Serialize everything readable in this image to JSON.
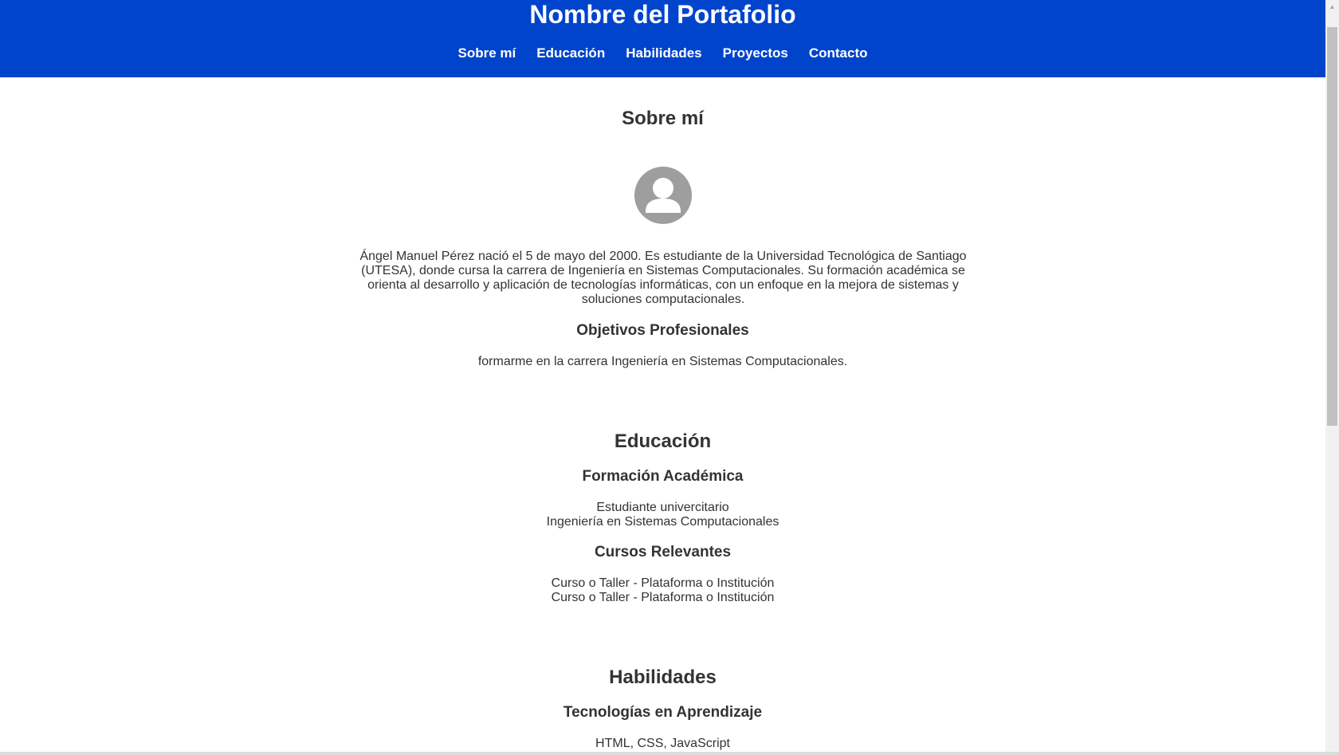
{
  "header": {
    "title": "Nombre del Portafolio",
    "nav": [
      "Sobre mí",
      "Educación",
      "Habilidades",
      "Proyectos",
      "Contacto"
    ]
  },
  "about": {
    "heading": "Sobre mí",
    "avatar_icon": "user-avatar-icon",
    "bio": "Ángel Manuel Pérez nació el 5 de mayo del 2000. Es estudiante de la Universidad Tecnológica de Santiago (UTESA), donde cursa la carrera de Ingeniería en Sistemas Computacionales. Su formación académica se orienta al desarrollo y aplicación de tecnologías informáticas, con un enfoque en la mejora de sistemas y soluciones computacionales.",
    "objectives_heading": "Objetivos Profesionales",
    "objectives_text": "formarme en la carrera Ingeniería en Sistemas Computacionales."
  },
  "education": {
    "heading": "Educación",
    "academic_heading": "Formación Académica",
    "academic_lines": [
      "Estudiante univercitario",
      "Ingeniería en Sistemas Computacionales"
    ],
    "courses_heading": "Cursos Relevantes",
    "courses_lines": [
      "Curso o Taller - Plataforma o Institución",
      "Curso o Taller - Plataforma o Institución"
    ]
  },
  "skills": {
    "heading": "Habilidades",
    "learning_heading": "Tecnologías en Aprendizaje",
    "learning_text": "HTML, CSS, JavaScript"
  },
  "colors": {
    "header_bg": "#0044cc",
    "text": "#333333",
    "avatar": "#9e9e9e"
  }
}
